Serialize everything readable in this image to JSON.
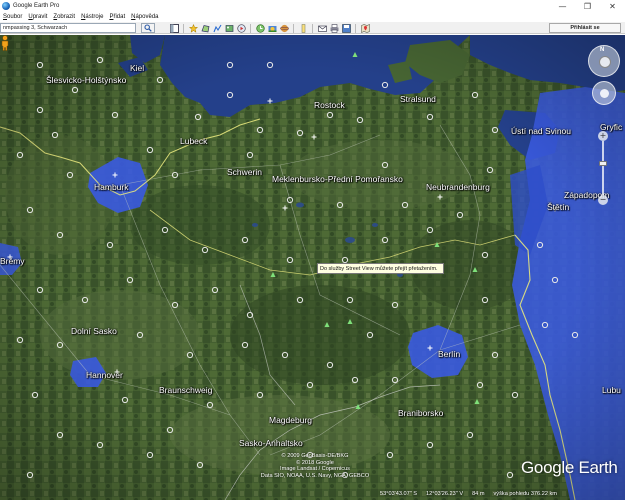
{
  "window": {
    "title": "Google Earth Pro",
    "minimize": "—",
    "maximize": "❐",
    "close": "✕"
  },
  "menu": [
    {
      "first": "S",
      "rest": "oubor"
    },
    {
      "first": "U",
      "rest": "pravit"
    },
    {
      "first": "Z",
      "rest": "obrazit"
    },
    {
      "first": "N",
      "rest": "ástroje"
    },
    {
      "first": "P",
      "rest": "řidat"
    },
    {
      "first": "N",
      "rest": "ápověda"
    }
  ],
  "search": {
    "value": "nmpassing 3, Schwarzach"
  },
  "toolbar": {
    "icons": [
      "sidebar-icon",
      "placemark-icon",
      "polygon-icon",
      "path-icon",
      "overlay-icon",
      "tour-icon",
      "historical-imagery-icon",
      "sunlight-icon",
      "planets-icon",
      "ruler-icon",
      "email-icon",
      "print-icon",
      "save-image-icon",
      "maps-icon"
    ],
    "signin_label": "Přihlásit se"
  },
  "map": {
    "labels": [
      {
        "text": "Kiel",
        "name": "label-kiel"
      },
      {
        "text": "Šlesvicko-Holštýnsko",
        "name": "label-schleswig-holstein"
      },
      {
        "text": "Stralsund",
        "name": "label-stralsund"
      },
      {
        "text": "Rostock",
        "name": "label-rostock"
      },
      {
        "text": "Ústí nad Svinou",
        "name": "label-swinoujscie"
      },
      {
        "text": "Lubeck",
        "name": "label-lubeck"
      },
      {
        "text": "Schwerin",
        "name": "label-schwerin"
      },
      {
        "text": "Meklenbursko-Přední Pomořansko",
        "name": "label-mecklenburg"
      },
      {
        "text": "Neubrandenburg",
        "name": "label-neubrandenburg"
      },
      {
        "text": "Hamburk",
        "name": "label-hamburg"
      },
      {
        "text": "Západopom",
        "name": "label-west-pomerania"
      },
      {
        "text": "Štětín",
        "name": "label-szczecin"
      },
      {
        "text": "Brémy",
        "name": "label-bremen"
      },
      {
        "text": "Dolní Sasko",
        "name": "label-lower-saxony"
      },
      {
        "text": "Berlín",
        "name": "label-berlin"
      },
      {
        "text": "Hannover",
        "name": "label-hannover"
      },
      {
        "text": "Braunschweig",
        "name": "label-braunschweig"
      },
      {
        "text": "Lubu",
        "name": "label-lubuskie"
      },
      {
        "text": "Magdeburg",
        "name": "label-magdeburg"
      },
      {
        "text": "Braniborsko",
        "name": "label-brandenburg"
      },
      {
        "text": "Sasko-Anhaltsko",
        "name": "label-saxony-anhalt"
      },
      {
        "text": "Gryfic",
        "name": "label-gryfice"
      }
    ],
    "streetview_tooltip": "Do služby Street View můžete přejít přetažením.",
    "nav_north": "N"
  },
  "attribution": [
    "© 2009 GeoBasis-DE/BKG",
    "© 2018 Google",
    "Image Landsat / Copernicus",
    "Data SIO, NOAA, U.S. Navy, NGA, GEBCO"
  ],
  "brand": "Google Earth",
  "status": {
    "lat": "53°03'43.07\" S",
    "lon": "12°03'26.23\" V",
    "elevation": "84 m",
    "eye_alt": "výška pohledu 376.22 km"
  },
  "colors": {
    "water": "#24408a",
    "land": "#3f5a2d",
    "city_overlay": "#3a5ae0",
    "border": "#e6e67a"
  }
}
